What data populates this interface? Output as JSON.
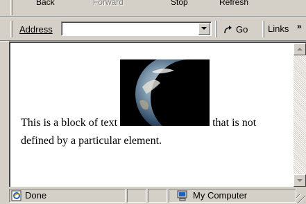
{
  "toolbar": {
    "back_label": "Back",
    "forward_label": "Forward",
    "stop_label": "Stop",
    "refresh_label": "Refresh"
  },
  "address_bar": {
    "label": "Address",
    "value": "",
    "go_label": "Go",
    "links_label": "Links",
    "more_label": "»"
  },
  "page": {
    "text_before": "This is a block of text ",
    "text_after": " that is not defined by a particular element.",
    "image_alt": "earth-image"
  },
  "status_bar": {
    "status": "Done",
    "zone": "My Computer"
  }
}
